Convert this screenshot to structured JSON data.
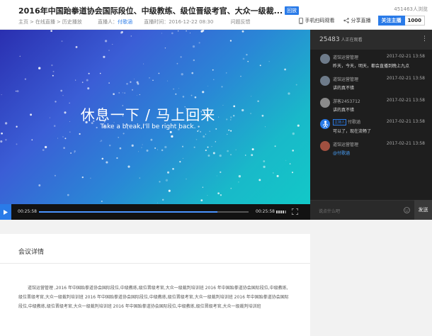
{
  "header": {
    "title": "2016年中国跆拳道协会国际段位、中级教练、级位晋级考官、大众一级裁...",
    "badge": "回放",
    "views": "451463人浏览",
    "breadcrumb": [
      "主页",
      "在线直播",
      "历史播放"
    ],
    "host_label": "直播人：",
    "host_name": "付歌涵",
    "time_label": "直播时间：",
    "time_value": "2016-12-22 08:30",
    "feedback": "问题反馈",
    "mobile_watch": "手机扫码观看",
    "share": "分享直播",
    "follow_label": "关注主播",
    "follow_count": "1000"
  },
  "video": {
    "headline_cn": "休息一下  /  马上回来",
    "headline_en": "Take a break,I'll be right back.",
    "time_current": "00:25:58",
    "time_total": "00:25:58",
    "progress": 0.85
  },
  "chat": {
    "viewers": "25483",
    "viewers_suffix": "人正在观看",
    "input_placeholder": "说点什么吧",
    "send_label": "发送",
    "messages": [
      {
        "name": "道馆运营管理",
        "time": "2017-02-21  13:58",
        "text": "昨天，今天，明天，都会直播到晚上九点",
        "color": "#6e7b8a"
      },
      {
        "name": "道馆运营管理",
        "time": "2017-02-21  13:58",
        "text": "讲的真不错",
        "color": "#6e7b8a"
      },
      {
        "name": "游客2453712",
        "time": "2017-02-21  13:58",
        "text": "讲的真不错",
        "color": "#8a8a8a"
      },
      {
        "name": "付歌涵",
        "badge": "主持人",
        "time": "2017-02-21  13:58",
        "text": "可以了，现在流畅了",
        "color": "#2a7be8"
      },
      {
        "name": "道馆运营管理",
        "time": "2017-02-21  13:58",
        "text": "@付歌涵",
        "color": "#a05040"
      }
    ]
  },
  "details": {
    "title": "会议详情",
    "body": "道馆运营管理 ,2016 年中国跆拳道协会国际段位,中级教练,级位晋级考官,大众一级裁判培训班 2016 年中国跆拳道协会国际段位,中级教练,级位晋级考官,大众一级裁判培训班 2016 年中国跆拳道协会国际段位,中级教练,级位晋级考官,大众一级裁判培训班 2016 年中国跆拳道协会国际段位,中级教练,级位晋级考官,大众一级裁判培训班 2016 年中国跆拳道协会国际段位,中级教练,级位晋级考官,大众一级裁判培训班"
  },
  "colors": {
    "accent": "#2a7be8",
    "chat_bg": "#1e1e1e",
    "video_gradient_start": "#2a2fb0",
    "video_gradient_end": "#12c8c8"
  },
  "icons": [
    "phone-icon",
    "share-icon",
    "play-icon",
    "volume-icon",
    "fullscreen-icon",
    "emoji-icon",
    "kebab-icon"
  ]
}
